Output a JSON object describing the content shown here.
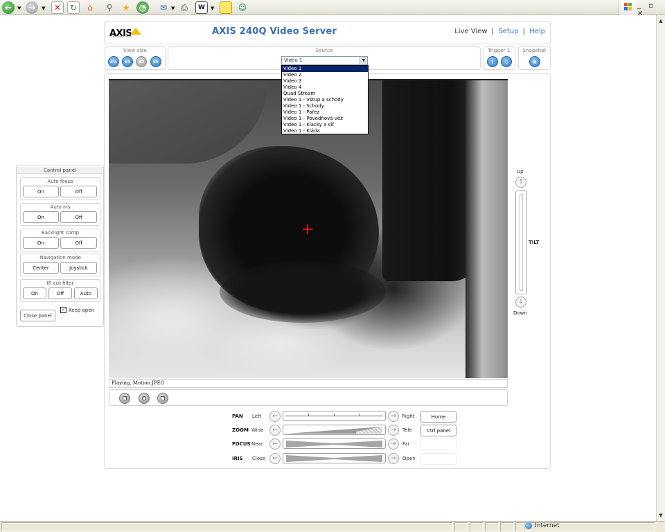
{
  "browser": {
    "toolbar_icons": [
      "back-icon",
      "forward-icon",
      "document-icon",
      "stop-icon",
      "refresh-icon",
      "home-icon",
      "search-icon",
      "favorites-star-icon",
      "history-icon",
      "mail-icon",
      "print-icon",
      "word-icon",
      "notes-icon",
      "messenger-icon"
    ],
    "status_zone": "Internet",
    "window_controls": "_ ▫ ×"
  },
  "header": {
    "logo": "AXIS",
    "logo_sub": "COMMUNICATIONS",
    "title": "AXIS 240Q Video Server",
    "nav": {
      "live_view": "Live View",
      "sep": "|",
      "setup": "Setup",
      "help": "Help"
    }
  },
  "view_size": {
    "label": "View size",
    "buttons": [
      "x½",
      "x1",
      "x2",
      "x4"
    ]
  },
  "source": {
    "label": "Source",
    "selected": "Video 1",
    "options": [
      "Video 1",
      "Video 2",
      "Video 3",
      "Video 4",
      "Quad Stream",
      "Video 1 - Vstup a schody",
      "Video 1 - Schody",
      "Video 1 - Pařez",
      "Video 1 - Povodňová věž",
      "Video 1 - Klacky a síť",
      "Video 1 - Kláda"
    ]
  },
  "trigger": {
    "label": "Trigger 1"
  },
  "snapshot": {
    "label": "Snapshot"
  },
  "video": {
    "status": "Playing, Motion JPEG"
  },
  "tilt": {
    "up": "Up",
    "down": "Down",
    "label": "TILT"
  },
  "ptz": {
    "pan": {
      "label": "PAN",
      "left": "Left",
      "right": "Right",
      "button": "Home"
    },
    "zoom": {
      "label": "ZOOM",
      "left": "Wide",
      "right": "Tele",
      "button": "Ctrl panel"
    },
    "focus": {
      "label": "FOCUS",
      "left": "Near",
      "right": "Far"
    },
    "iris": {
      "label": "IRIS",
      "left": "Close",
      "right": "Open"
    }
  },
  "control_panel": {
    "title": "Control panel",
    "auto_focus": {
      "label": "Auto focus",
      "on": "On",
      "off": "Off"
    },
    "auto_iris": {
      "label": "Auto iris",
      "on": "On",
      "off": "Off"
    },
    "backlight": {
      "label": "Backlight comp",
      "on": "On",
      "off": "Off"
    },
    "navigation": {
      "label": "Navigation mode",
      "center": "Center",
      "joystick": "Joystick"
    },
    "ir_cut": {
      "label": "IR cut filter",
      "on": "On",
      "off": "Off",
      "auto": "Auto"
    },
    "close": "Close panel",
    "keep_open": "Keep open",
    "keep_open_checked": true
  }
}
